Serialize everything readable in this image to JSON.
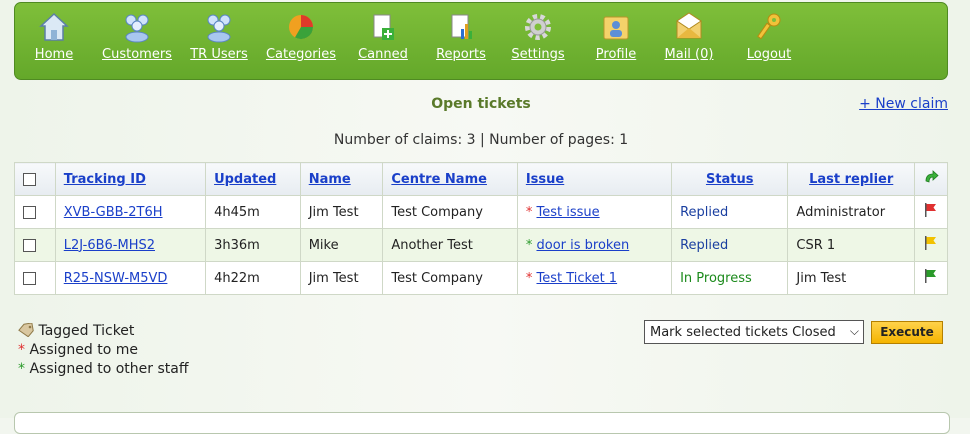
{
  "nav": {
    "items": [
      {
        "label": "Home",
        "icon": "home-icon"
      },
      {
        "label": "Customers",
        "icon": "customers-icon"
      },
      {
        "label": "TR Users",
        "icon": "tr-users-icon"
      },
      {
        "label": "Categories",
        "icon": "categories-pie-icon"
      },
      {
        "label": "Canned",
        "icon": "canned-doc-icon"
      },
      {
        "label": "Reports",
        "icon": "reports-icon"
      },
      {
        "label": "Settings",
        "icon": "gear-icon"
      },
      {
        "label": "Profile",
        "icon": "profile-icon"
      },
      {
        "label": "Mail (0)",
        "icon": "mail-icon"
      },
      {
        "label": "Logout",
        "icon": "key-icon"
      }
    ]
  },
  "main": {
    "title": "Open tickets",
    "new_claim": "+ New claim",
    "counts": "Number of claims: 3 | Number of pages: 1"
  },
  "table": {
    "headers": [
      "Tracking ID",
      "Updated",
      "Name",
      "Centre Name",
      "Issue",
      "Status",
      "Last replier"
    ],
    "rows": [
      {
        "id": "XVB-GBB-2T6H",
        "updated": "4h45m",
        "name": "Jim Test",
        "centre": "Test Company",
        "issue": "Test issue",
        "assigned": "me",
        "status": "Replied",
        "replier": "Administrator",
        "flag": "red"
      },
      {
        "id": "L2J-6B6-MHS2",
        "updated": "3h36m",
        "name": "Mike",
        "centre": "Another Test",
        "issue": "door is broken",
        "assigned": "other",
        "status": "Replied",
        "replier": "CSR 1",
        "flag": "yellow"
      },
      {
        "id": "R25-NSW-M5VD",
        "updated": "4h22m",
        "name": "Jim Test",
        "centre": "Test Company",
        "issue": "Test Ticket 1",
        "assigned": "me",
        "status": "In Progress",
        "replier": "Jim Test",
        "flag": "green"
      }
    ]
  },
  "legend": {
    "tagged": "Tagged Ticket",
    "assigned_me": "Assigned to me",
    "assigned_other": "Assigned to other staff",
    "star": "*"
  },
  "actions": {
    "select_value": "Mark selected tickets Closed",
    "execute": "Execute"
  },
  "colors": {
    "accent": "#6ab02e",
    "link": "#1a3fc9",
    "flag_red": "#e03030",
    "flag_yellow": "#f2c200",
    "flag_green": "#2a9a2a"
  }
}
